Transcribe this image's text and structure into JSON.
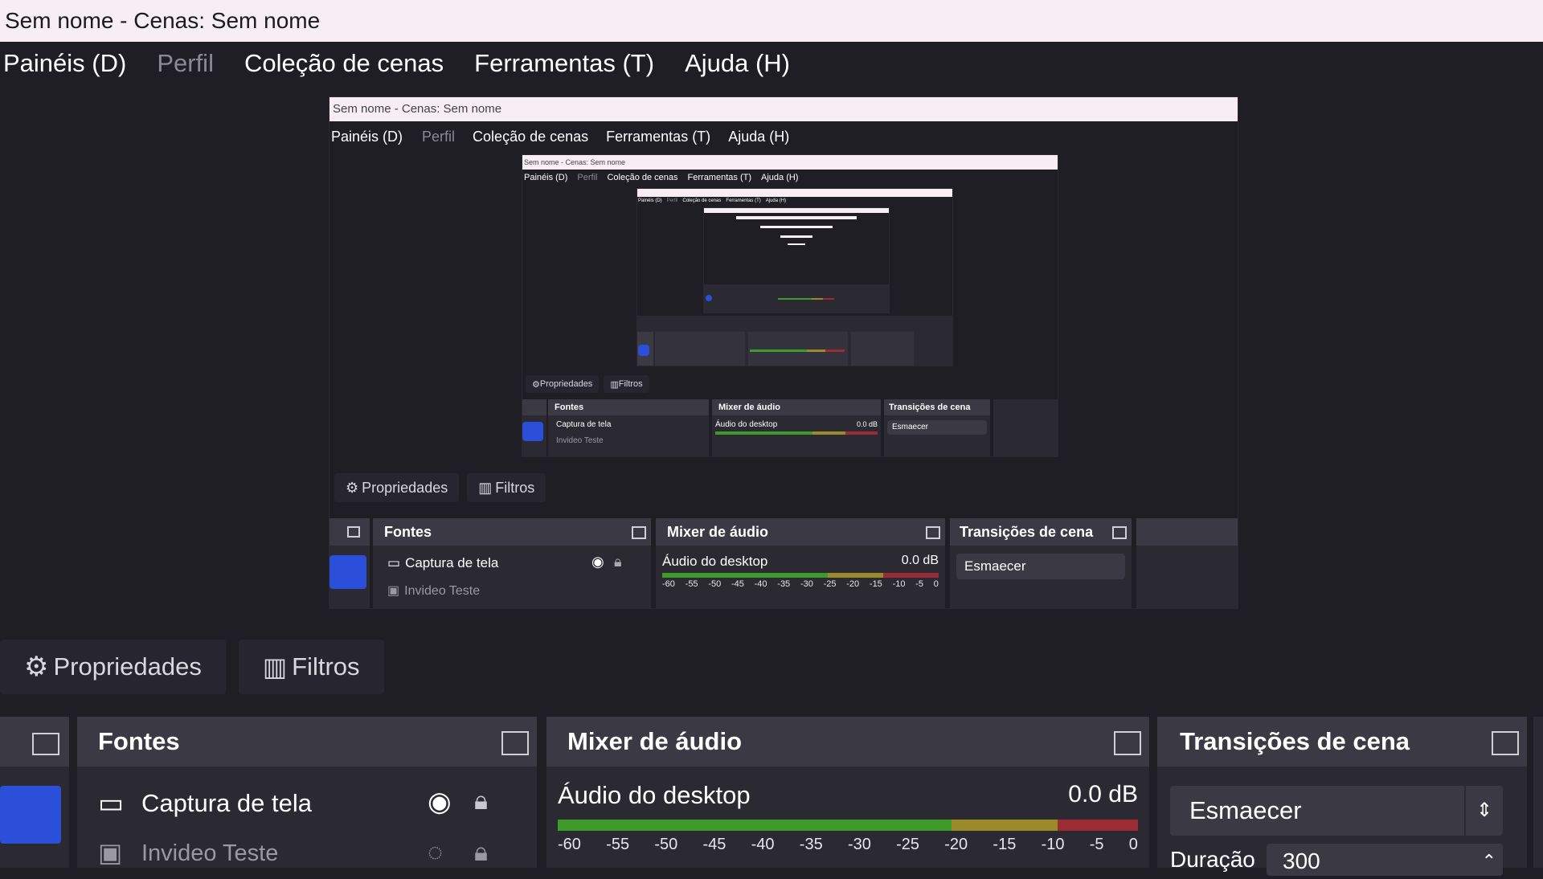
{
  "window": {
    "title": "Sem nome - Cenas: Sem nome"
  },
  "menu": {
    "items": [
      {
        "label": "Painéis (D)",
        "enabled": true
      },
      {
        "label": "Perfil",
        "enabled": false
      },
      {
        "label": "Coleção de cenas",
        "enabled": true
      },
      {
        "label": "Ferramentas (T)",
        "enabled": true
      },
      {
        "label": "Ajuda (H)",
        "enabled": true
      }
    ]
  },
  "tabs": {
    "properties": "Propriedades",
    "filters": "Filtros"
  },
  "sources": {
    "title": "Fontes",
    "items": [
      {
        "name": "Captura de tela",
        "icon": "monitor-icon"
      },
      {
        "name": "Invideo Teste",
        "icon": "image-icon"
      }
    ]
  },
  "mixer": {
    "title": "Mixer de áudio",
    "channel": "Áudio do desktop",
    "level": "0.0 dB",
    "ticks": [
      "-60",
      "-55",
      "-50",
      "-45",
      "-40",
      "-35",
      "-30",
      "-25",
      "-20",
      "-15",
      "-10",
      "-5",
      "0"
    ]
  },
  "transitions": {
    "title": "Transições de cena",
    "selected": "Esmaecer",
    "duration_label": "Duração",
    "duration_value": "300"
  },
  "colors": {
    "background": "#1f1e25",
    "dock": "#2b2a33",
    "dock_header": "#3a3944",
    "accent_blue": "#2b4fd8",
    "meter_green": "#3e9b2b",
    "meter_yellow": "#9b8a2b",
    "meter_red": "#9b2b35",
    "titlebar": "#f6eef3"
  }
}
